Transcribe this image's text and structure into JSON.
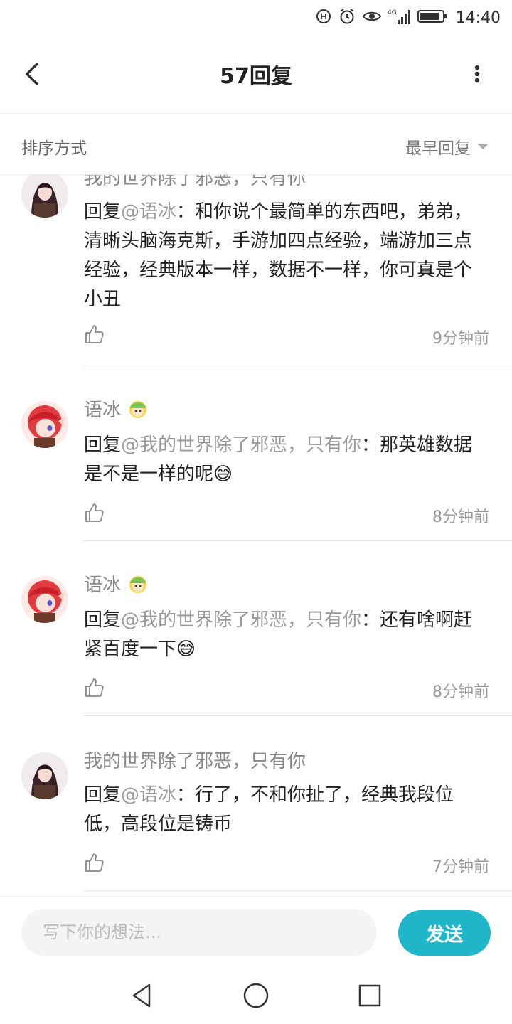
{
  "status_bar": {
    "time": "14:40",
    "network": "4G",
    "icons": [
      "data-saver-icon",
      "alarm-icon",
      "eye-comfort-icon",
      "signal-icon",
      "battery-icon"
    ]
  },
  "header": {
    "title": "57回复",
    "back_icon": "back-arrow-icon",
    "more_icon": "more-vertical-icon"
  },
  "sort": {
    "label": "排序方式",
    "value": "最早回复"
  },
  "comments": [
    {
      "author": "我的世界除了邪恶，只有你",
      "reply_prefix": "回复",
      "mention": "@语冰",
      "colon": "：",
      "text": "和你说个最简单的东西吧，弟弟，清晰头脑海克斯，手游加四点经验，端游加三点经验，经典版本一样，数据不一样，你可真是个小丑",
      "time": "9分钟前"
    },
    {
      "author": "语冰",
      "reply_prefix": "回复",
      "mention": "@我的世界除了邪恶，只有你",
      "colon": "：",
      "text": "那英雄数据是不是一样的呢😅",
      "time": "8分钟前"
    },
    {
      "author": "语冰",
      "reply_prefix": "回复",
      "mention": "@我的世界除了邪恶，只有你",
      "colon": "：",
      "text": "还有啥啊赶紧百度一下😅",
      "time": "8分钟前"
    },
    {
      "author": "我的世界除了邪恶，只有你",
      "reply_prefix": "回复",
      "mention": "@语冰",
      "colon": "：",
      "text": "行了，不和你扯了，经典我段位低，高段位是铸币",
      "time": "7分钟前"
    }
  ],
  "composer": {
    "placeholder": "写下你的想法...",
    "send_label": "发送"
  },
  "colors": {
    "accent": "#1fb6c9",
    "secondary_text": "#999999"
  }
}
